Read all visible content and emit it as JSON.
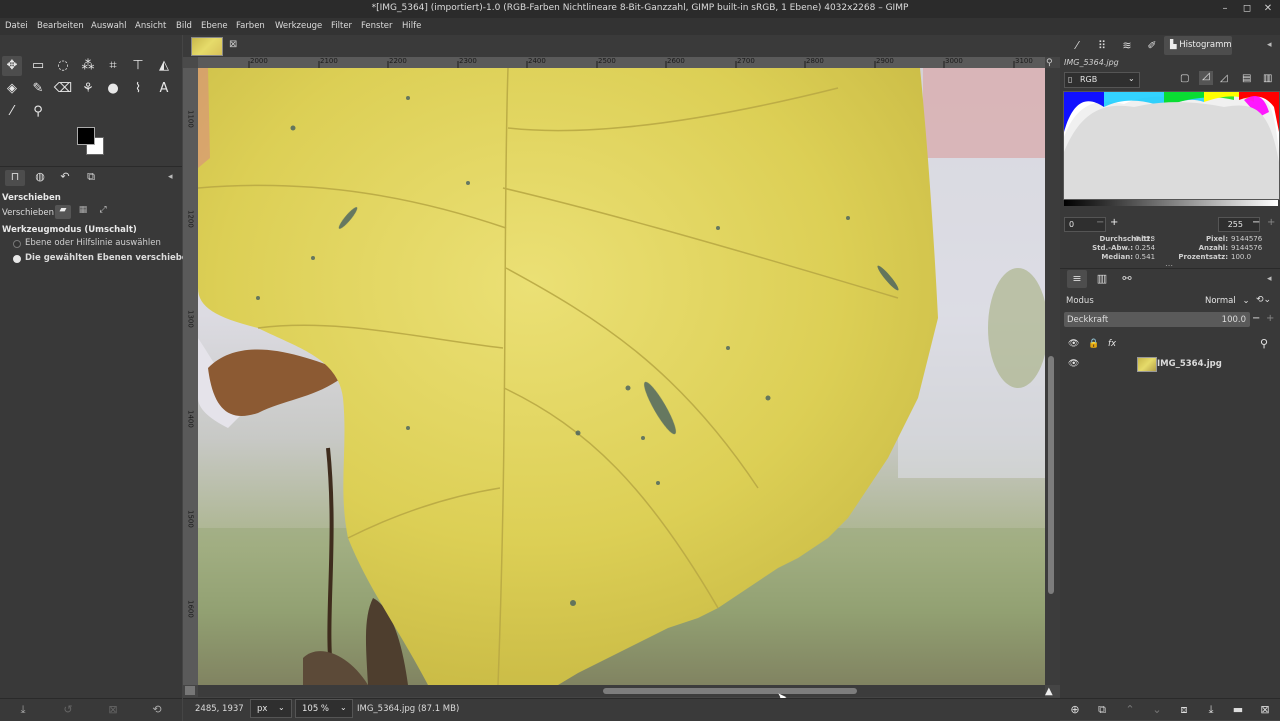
{
  "window": {
    "title": "*[IMG_5364] (importiert)-1.0 (RGB-Farben Nichtlineare 8-Bit-Ganzzahl, GIMP built-in sRGB, 1 Ebene) 4032x2268 – GIMP"
  },
  "menu": [
    "Datei",
    "Bearbeiten",
    "Auswahl",
    "Ansicht",
    "Bild",
    "Ebene",
    "Farben",
    "Werkzeuge",
    "Filter",
    "Fenster",
    "Hilfe"
  ],
  "tool_options": {
    "title": "Verschieben",
    "move_label": "Verschieben:",
    "mode_title": "Werkzeugmodus (Umschalt)",
    "option_1": "Ebene oder Hilfslinie auswählen",
    "option_2": "Die gewählten Ebenen verschieben",
    "selected_option": 2
  },
  "rulers": {
    "top": [
      "2000",
      "2100",
      "2200",
      "2300",
      "2400",
      "2500",
      "2600",
      "2700",
      "2800",
      "2900",
      "3000",
      "3100"
    ],
    "left": [
      "1100",
      "1200",
      "1300",
      "1400",
      "1500",
      "1600"
    ]
  },
  "status": {
    "coords": "2485, 1937",
    "unit": "px",
    "zoom": "105 %",
    "info": "IMG_5364.jpg (87.1 MB)"
  },
  "histogram": {
    "tab_label": "Histogramm",
    "image_name": "IMG_5364.jpg",
    "channel": "RGB",
    "range_low": "0",
    "range_high": "255",
    "stats_left": [
      {
        "label": "Durchschnitt:",
        "value": "0.523"
      },
      {
        "label": "Std.-Abw.:",
        "value": "0.254"
      },
      {
        "label": "Median:",
        "value": "0.541"
      }
    ],
    "stats_right": [
      {
        "label": "Pixel:",
        "value": "9144576"
      },
      {
        "label": "Anzahl:",
        "value": "9144576"
      },
      {
        "label": "Prozentsatz:",
        "value": "100.0"
      }
    ]
  },
  "layers": {
    "mode_label": "Modus",
    "mode_value": "Normal",
    "opacity_label": "Deckkraft",
    "opacity_value": "100.0",
    "items": [
      {
        "name": "IMG_5364.jpg",
        "visible": true
      }
    ]
  },
  "colors": {
    "foreground": "#000000",
    "background": "#ffffff",
    "leaf": "#e3d65a"
  }
}
